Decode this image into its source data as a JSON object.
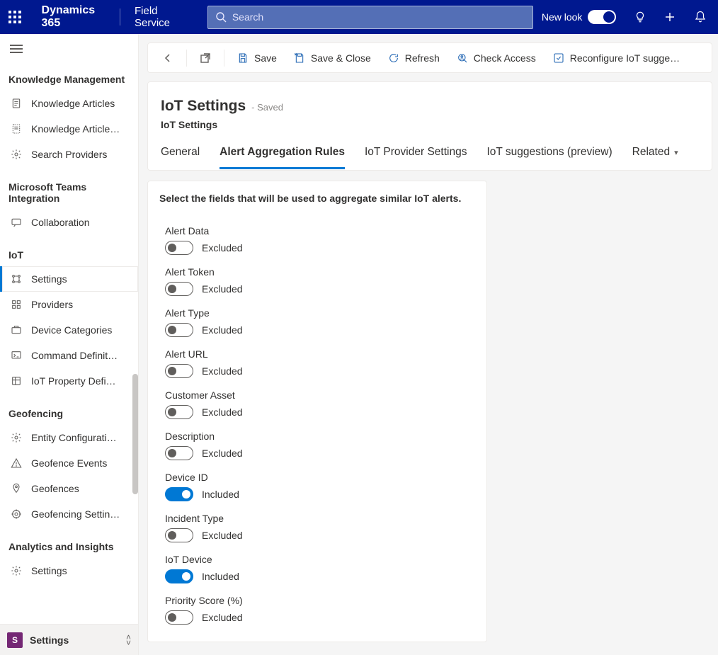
{
  "header": {
    "brand": "Dynamics 365",
    "app": "Field Service",
    "search_placeholder": "Search",
    "new_look": "New look"
  },
  "sidebar": {
    "sections": [
      {
        "title": "Knowledge Management",
        "items": [
          {
            "icon": "doc",
            "label": "Knowledge Articles"
          },
          {
            "icon": "doc-dashed",
            "label": "Knowledge Article…"
          },
          {
            "icon": "gear",
            "label": "Search Providers"
          }
        ]
      },
      {
        "title": "Microsoft Teams Integration",
        "items": [
          {
            "icon": "chat",
            "label": "Collaboration"
          }
        ]
      },
      {
        "title": "IoT",
        "items": [
          {
            "icon": "nodes",
            "label": "Settings",
            "selected": true
          },
          {
            "icon": "grid",
            "label": "Providers"
          },
          {
            "icon": "devcat",
            "label": "Device Categories"
          },
          {
            "icon": "cmd",
            "label": "Command Definit…"
          },
          {
            "icon": "prop",
            "label": "IoT Property Defi…"
          }
        ]
      },
      {
        "title": "Geofencing",
        "items": [
          {
            "icon": "gear",
            "label": "Entity Configurati…"
          },
          {
            "icon": "warn",
            "label": "Geofence Events"
          },
          {
            "icon": "pin",
            "label": "Geofences"
          },
          {
            "icon": "target",
            "label": "Geofencing Settin…"
          }
        ]
      },
      {
        "title": "Analytics and Insights",
        "items": [
          {
            "icon": "gear",
            "label": "Settings"
          }
        ]
      }
    ],
    "area": {
      "badge": "S",
      "label": "Settings"
    }
  },
  "commands": {
    "back": "",
    "popout": "",
    "items": [
      {
        "icon": "save",
        "label": "Save"
      },
      {
        "icon": "saveclose",
        "label": "Save & Close"
      },
      {
        "icon": "refresh",
        "label": "Refresh"
      },
      {
        "icon": "access",
        "label": "Check Access"
      },
      {
        "icon": "reconf",
        "label": "Reconfigure IoT sugge…"
      }
    ]
  },
  "page": {
    "title": "IoT Settings",
    "saved": "- Saved",
    "subtitle": "IoT Settings",
    "tabs": [
      {
        "label": "General"
      },
      {
        "label": "Alert Aggregation Rules",
        "active": true
      },
      {
        "label": "IoT Provider Settings"
      },
      {
        "label": "IoT suggestions (preview)"
      },
      {
        "label": "Related",
        "dropdown": true
      }
    ]
  },
  "form": {
    "instruction": "Select the fields that will be used to aggregate similar IoT alerts.",
    "states": {
      "on": "Included",
      "off": "Excluded"
    },
    "fields": [
      {
        "label": "Alert Data",
        "on": false
      },
      {
        "label": "Alert Token",
        "on": false
      },
      {
        "label": "Alert Type",
        "on": false
      },
      {
        "label": "Alert URL",
        "on": false
      },
      {
        "label": "Customer Asset",
        "on": false
      },
      {
        "label": "Description",
        "on": false
      },
      {
        "label": "Device ID",
        "on": true
      },
      {
        "label": "Incident Type",
        "on": false
      },
      {
        "label": "IoT Device",
        "on": true
      },
      {
        "label": "Priority Score (%)",
        "on": false
      }
    ]
  }
}
